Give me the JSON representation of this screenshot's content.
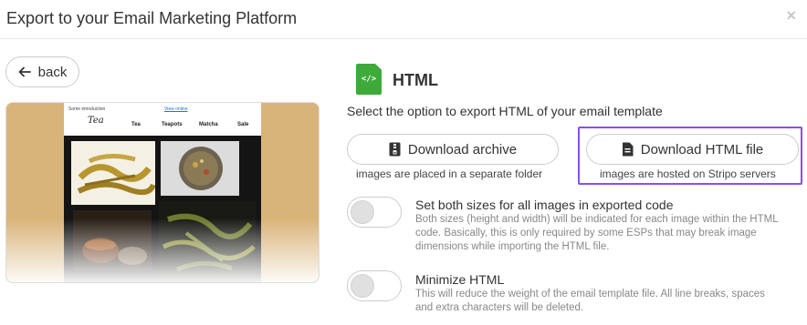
{
  "header": {
    "title": "Export to your Email Marketing Platform",
    "close_glyph": "×"
  },
  "back_button": {
    "label": "back",
    "icon": "arrow-left-icon"
  },
  "preview": {
    "intro_text": "Some introduction",
    "view_online": "View online",
    "logo": "Tea",
    "nav": [
      "Tea",
      "Teapots",
      "Matcha",
      "Sale"
    ]
  },
  "format": {
    "icon_text": "</>",
    "title": "HTML"
  },
  "subtitle": "Select the option to export HTML of your email template",
  "download_archive": {
    "label": "Download archive",
    "caption": "images are placed in a separate folder",
    "icon": "archive-icon"
  },
  "download_html": {
    "label": "Download HTML file",
    "caption": "images are hosted on Stripo servers",
    "icon": "file-icon"
  },
  "options": {
    "set_sizes": {
      "title": "Set both sizes for all images in exported code",
      "description": "Both sizes (height and width) will be indicated for each image within the HTML code. Basically, this is only required by some ESPs that may break image dimensions while importing the HTML file.",
      "enabled": false
    },
    "minimize": {
      "title": "Minimize HTML",
      "description": "This will reduce the weight of the email template file. All line breaks, spaces and extra characters will be deleted.",
      "enabled": false
    }
  },
  "colors": {
    "accent_highlight": "#8a4ee8",
    "html_icon": "#3eaa3a"
  }
}
